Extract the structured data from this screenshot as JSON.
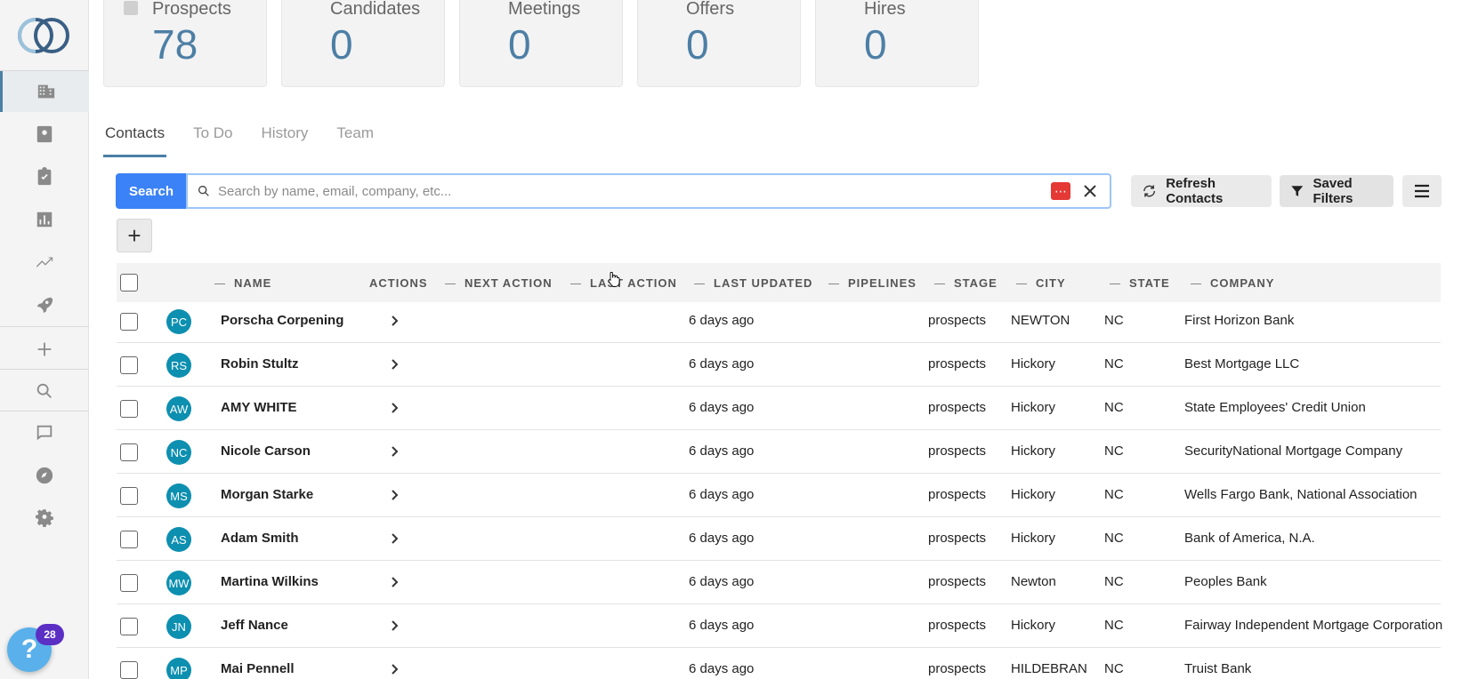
{
  "stats": [
    {
      "label": "Prospects",
      "value": "78"
    },
    {
      "label": "Candidates",
      "value": "0"
    },
    {
      "label": "Meetings",
      "value": "0"
    },
    {
      "label": "Offers",
      "value": "0"
    },
    {
      "label": "Hires",
      "value": "0"
    }
  ],
  "tabs": [
    {
      "label": "Contacts",
      "active": true
    },
    {
      "label": "To Do",
      "active": false
    },
    {
      "label": "History",
      "active": false
    },
    {
      "label": "Team",
      "active": false
    }
  ],
  "search": {
    "button_label": "Search",
    "placeholder": "Search by name, email, company, etc...",
    "value": ""
  },
  "toolbar": {
    "refresh_label": "Refresh Contacts",
    "saved_filters_label": "Saved Filters",
    "add_label": "+"
  },
  "help": {
    "badge": "28",
    "label": "?"
  },
  "table": {
    "columns": {
      "name": "NAME",
      "actions": "ACTIONS",
      "next_action": "NEXT ACTION",
      "last_action": "LAST ACTION",
      "last_updated": "LAST UPDATED",
      "pipelines": "PIPELINES",
      "stage": "STAGE",
      "city": "CITY",
      "state": "STATE",
      "company": "COMPANY"
    },
    "rows": [
      {
        "initials": "PC",
        "name": "Porscha Corpening",
        "last_updated": "6 days ago",
        "stage": "prospects",
        "city": "NEWTON",
        "state": "NC",
        "company": "First Horizon Bank"
      },
      {
        "initials": "RS",
        "name": "Robin Stultz",
        "last_updated": "6 days ago",
        "stage": "prospects",
        "city": "Hickory",
        "state": "NC",
        "company": "Best Mortgage LLC"
      },
      {
        "initials": "AW",
        "name": "AMY WHITE",
        "last_updated": "6 days ago",
        "stage": "prospects",
        "city": "Hickory",
        "state": "NC",
        "company": "State Employees' Credit Union"
      },
      {
        "initials": "NC",
        "name": "Nicole Carson",
        "last_updated": "6 days ago",
        "stage": "prospects",
        "city": "Hickory",
        "state": "NC",
        "company": "SecurityNational Mortgage Company"
      },
      {
        "initials": "MS",
        "name": "Morgan Starke",
        "last_updated": "6 days ago",
        "stage": "prospects",
        "city": "Hickory",
        "state": "NC",
        "company": "Wells Fargo Bank, National Association"
      },
      {
        "initials": "AS",
        "name": "Adam Smith",
        "last_updated": "6 days ago",
        "stage": "prospects",
        "city": "Hickory",
        "state": "NC",
        "company": "Bank of America, N.A."
      },
      {
        "initials": "MW",
        "name": "Martina Wilkins",
        "last_updated": "6 days ago",
        "stage": "prospects",
        "city": "Newton",
        "state": "NC",
        "company": "Peoples Bank"
      },
      {
        "initials": "JN",
        "name": "Jeff Nance",
        "last_updated": "6 days ago",
        "stage": "prospects",
        "city": "Hickory",
        "state": "NC",
        "company": "Fairway Independent Mortgage Corporation"
      },
      {
        "initials": "MP",
        "name": "Mai Pennell",
        "last_updated": "6 days ago",
        "stage": "prospects",
        "city": "HILDEBRAN",
        "state": "NC",
        "company": "Truist Bank"
      }
    ]
  },
  "colors": {
    "accent": "#4a7fa6",
    "search_button": "#3b82f6",
    "avatar": "#0d8fb0",
    "help": "#5ab0ea",
    "badge": "#5b2fc4"
  }
}
